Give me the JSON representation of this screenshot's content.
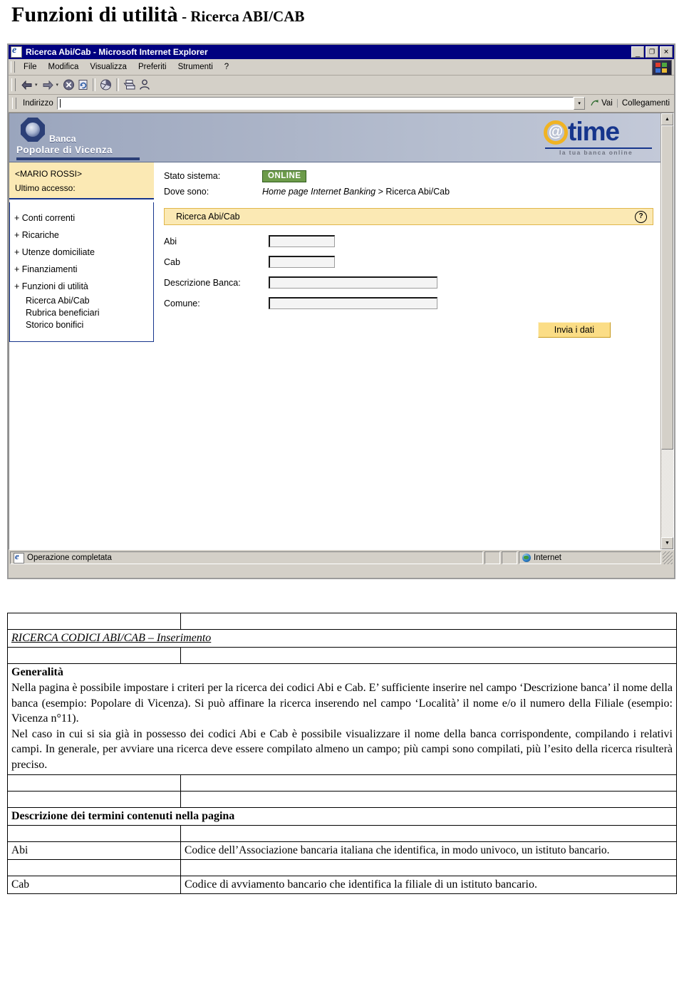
{
  "heading": {
    "main": "Funzioni di utilità",
    "sub": " - Ricerca ABI/CAB"
  },
  "browser": {
    "title": "Ricerca Abi/Cab - Microsoft Internet Explorer",
    "window_buttons": {
      "minimize": "_",
      "maximize": "❐",
      "close": "✕"
    },
    "menu": [
      "File",
      "Modifica",
      "Visualizza",
      "Preferiti",
      "Strumenti",
      "?"
    ],
    "toolbar": {
      "back": "←",
      "forward": "→",
      "stop": "✕",
      "refresh": "⟳",
      "home": "⌂",
      "print": "🖶",
      "edit": "👤",
      "caret": "▾"
    },
    "address": {
      "label": "Indirizzo",
      "value": "",
      "placeholder": "",
      "dropdown": "▾",
      "go": "Vai",
      "links": "Collegamenti"
    },
    "statusbar": {
      "message": "Operazione completata",
      "zone": "Internet"
    },
    "scrollbar": {
      "up": "▲",
      "down": "▼"
    }
  },
  "bank": {
    "logo_line1": "Banca",
    "logo_line2": "Popolare di Vicenza",
    "brand_at": "@",
    "brand_word": "time",
    "brand_tagline": "la tua banca online"
  },
  "user": {
    "name": "<MARIO ROSSI>",
    "last_access_label": "Ultimo accesso:"
  },
  "nav": {
    "items": [
      "+ Conti correnti",
      "+ Ricariche",
      "+ Utenze domiciliate",
      "+ Finanziamenti",
      "+ Funzioni di utilità"
    ],
    "subitems": [
      "Ricerca Abi/Cab",
      "Rubrica beneficiari",
      "Storico bonifici"
    ]
  },
  "status": {
    "system_label": "Stato sistema:",
    "system_value": "ONLINE",
    "where_label": "Dove sono:",
    "crumb_italic": "Home page Internet Banking",
    "crumb_sep": " > ",
    "crumb_current": "Ricerca Abi/Cab"
  },
  "panel": {
    "title": "Ricerca Abi/Cab",
    "help": "?",
    "fields": [
      {
        "label": "Abi",
        "value": "",
        "size": "short"
      },
      {
        "label": "Cab",
        "value": "",
        "size": "short"
      },
      {
        "label": "Descrizione Banca:",
        "value": "",
        "size": "long"
      },
      {
        "label": "Comune:",
        "value": "",
        "size": "long"
      }
    ],
    "submit": "Invia i dati"
  },
  "doc": {
    "section_title": "RICERCA CODICI ABI/CAB – Inserimento",
    "generalita_heading": "Generalità",
    "generalita_p1": "Nella pagina è possibile impostare i criteri per la ricerca dei codici Abi e Cab. E’ sufficiente inserire nel campo ‘Descrizione banca’ il nome della banca (esempio: Popolare di Vicenza). Si può affinare la ricerca inserendo nel campo ‘Località’ il nome  e/o il numero della Filiale (esempio: Vicenza n°11).",
    "generalita_p2": "Nel caso in cui si sia già in possesso dei codici Abi e Cab è possibile visualizzare il nome della banca corrispondente, compilando i relativi campi. In generale, per avviare una ricerca deve essere compilato almeno un campo; più campi sono compilati, più l’esito della ricerca risulterà preciso.",
    "terms_heading": "Descrizione dei termini contenuti nella pagina",
    "terms": [
      {
        "term": "Abi",
        "definition": "Codice dell’Associazione bancaria italiana che identifica, in modo univoco, un istituto bancario."
      },
      {
        "term": "Cab",
        "definition": "Codice di avviamento bancario che identifica la filiale di un istituto bancario."
      }
    ]
  }
}
